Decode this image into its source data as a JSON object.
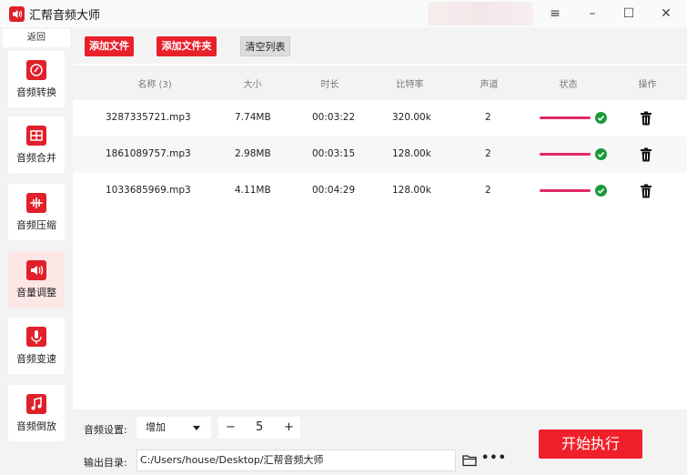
{
  "app": {
    "title": "汇帮音频大师"
  },
  "window": {
    "menu_icon": "≡",
    "minimize_icon": "–",
    "maximize_icon": "☐",
    "close_icon": "✕"
  },
  "sidebar": {
    "back_label": "返回",
    "items": [
      {
        "label": "音频转换",
        "icon": "audio-convert-icon",
        "active": false
      },
      {
        "label": "音频合并",
        "icon": "audio-merge-icon",
        "active": false
      },
      {
        "label": "音频压缩",
        "icon": "audio-compress-icon",
        "active": false
      },
      {
        "label": "音量调整",
        "icon": "volume-icon",
        "active": true
      },
      {
        "label": "音频变速",
        "icon": "speed-icon",
        "active": false
      },
      {
        "label": "音频倒放",
        "icon": "reverse-icon",
        "active": false
      }
    ]
  },
  "toolbar": {
    "add_file": "添加文件",
    "add_folder": "添加文件夹",
    "clear_list": "清空列表"
  },
  "table": {
    "headers": [
      "名称 (3)",
      "大小",
      "时长",
      "比特率",
      "声道",
      "状态",
      "操作"
    ],
    "rows": [
      {
        "name": "3287335721.mp3",
        "size": "7.74MB",
        "duration": "00:03:22",
        "bitrate": "320.00k",
        "channels": "2"
      },
      {
        "name": "1861089757.mp3",
        "size": "2.98MB",
        "duration": "00:03:15",
        "bitrate": "128.00k",
        "channels": "2"
      },
      {
        "name": "1033685969.mp3",
        "size": "4.11MB",
        "duration": "00:04:29",
        "bitrate": "128.00k",
        "channels": "2"
      }
    ]
  },
  "settings": {
    "audio_label": "音频设置:",
    "mode_value": "增加",
    "minus": "−",
    "amount": "5",
    "plus": "+",
    "output_label": "输出目录:",
    "output_path": "C:/Users/house/Desktop/汇帮音频大师",
    "more": "•••"
  },
  "actions": {
    "start": "开始执行"
  },
  "colors": {
    "accent": "#e8202a",
    "status_bar": "#e0296a",
    "success": "#1a9a3a",
    "active_bg": "#fde6e6"
  }
}
